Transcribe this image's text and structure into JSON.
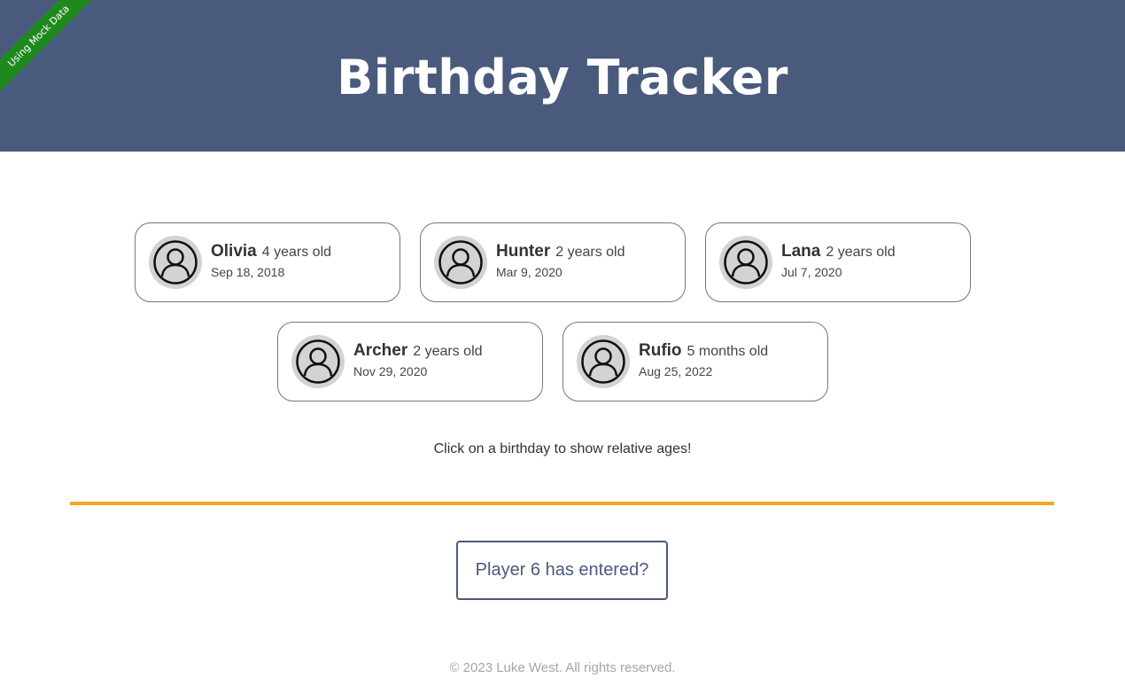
{
  "header": {
    "title": "Birthday Tracker",
    "ribbon": "Using Mock Data",
    "background_color": "#4a5a7c",
    "ribbon_color": "#1e8a1e"
  },
  "birthdays": [
    {
      "name": "Olivia",
      "age": "4 years old",
      "date": "Sep 18, 2018"
    },
    {
      "name": "Hunter",
      "age": "2 years old",
      "date": "Mar 9, 2020"
    },
    {
      "name": "Lana",
      "age": "2 years old",
      "date": "Jul 7, 2020"
    },
    {
      "name": "Archer",
      "age": "2 years old",
      "date": "Nov 29, 2020"
    },
    {
      "name": "Rufio",
      "age": "5 months old",
      "date": "Aug 25, 2022"
    }
  ],
  "avatar_icon": "user-circle-icon",
  "hint": "Click on a birthday to show relative ages!",
  "divider_color": "#f5a623",
  "player_button": "Player 6 has entered?",
  "footer": "© 2023 Luke West. All rights reserved."
}
